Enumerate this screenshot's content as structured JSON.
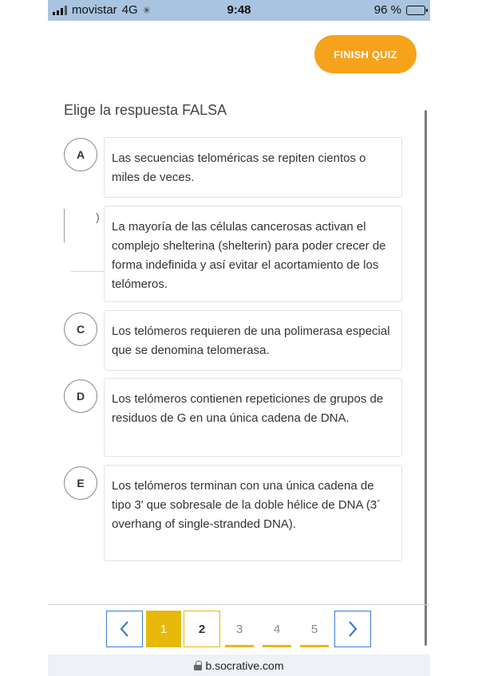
{
  "status_bar": {
    "carrier": "movistar",
    "network": "4G",
    "time": "9:48",
    "battery": "96 %",
    "battery_level": 0.96
  },
  "finish_button": "FINISH QUIZ",
  "question": "Elige la respuesta FALSA",
  "options": [
    {
      "letter": "A",
      "text": "Las secuencias teloméricas se repiten cientos o miles de veces."
    },
    {
      "letter": "",
      "text": "La mayoría de las células cancerosas activan el complejo shelterina (shelterin) para poder crecer de forma indefinida y así evitar el acortamiento de los telómeros."
    },
    {
      "letter": "C",
      "text": "Los telómeros requieren de una polimerasa especial que se denomina telomerasa."
    },
    {
      "letter": "D",
      "text": "Los telómeros contienen repeticiones de grupos de residuos de G en una única cadena de DNA."
    },
    {
      "letter": "E",
      "text": "Los telómeros terminan con una única cadena de tipo 3′ que sobresale de la doble hélice de DNA (3´ overhang of single-stranded DNA)."
    }
  ],
  "pagination": {
    "pages": [
      "1",
      "2",
      "3",
      "4",
      "5"
    ],
    "answered_page": "1",
    "current_page": "2",
    "prev_icon": "chevron-left-icon",
    "next_icon": "chevron-right-icon"
  },
  "url": "b.socrative.com",
  "colors": {
    "accent_orange": "#f7a21b",
    "accent_yellow": "#e8b90a",
    "arrow_blue": "#3d7bd6"
  }
}
